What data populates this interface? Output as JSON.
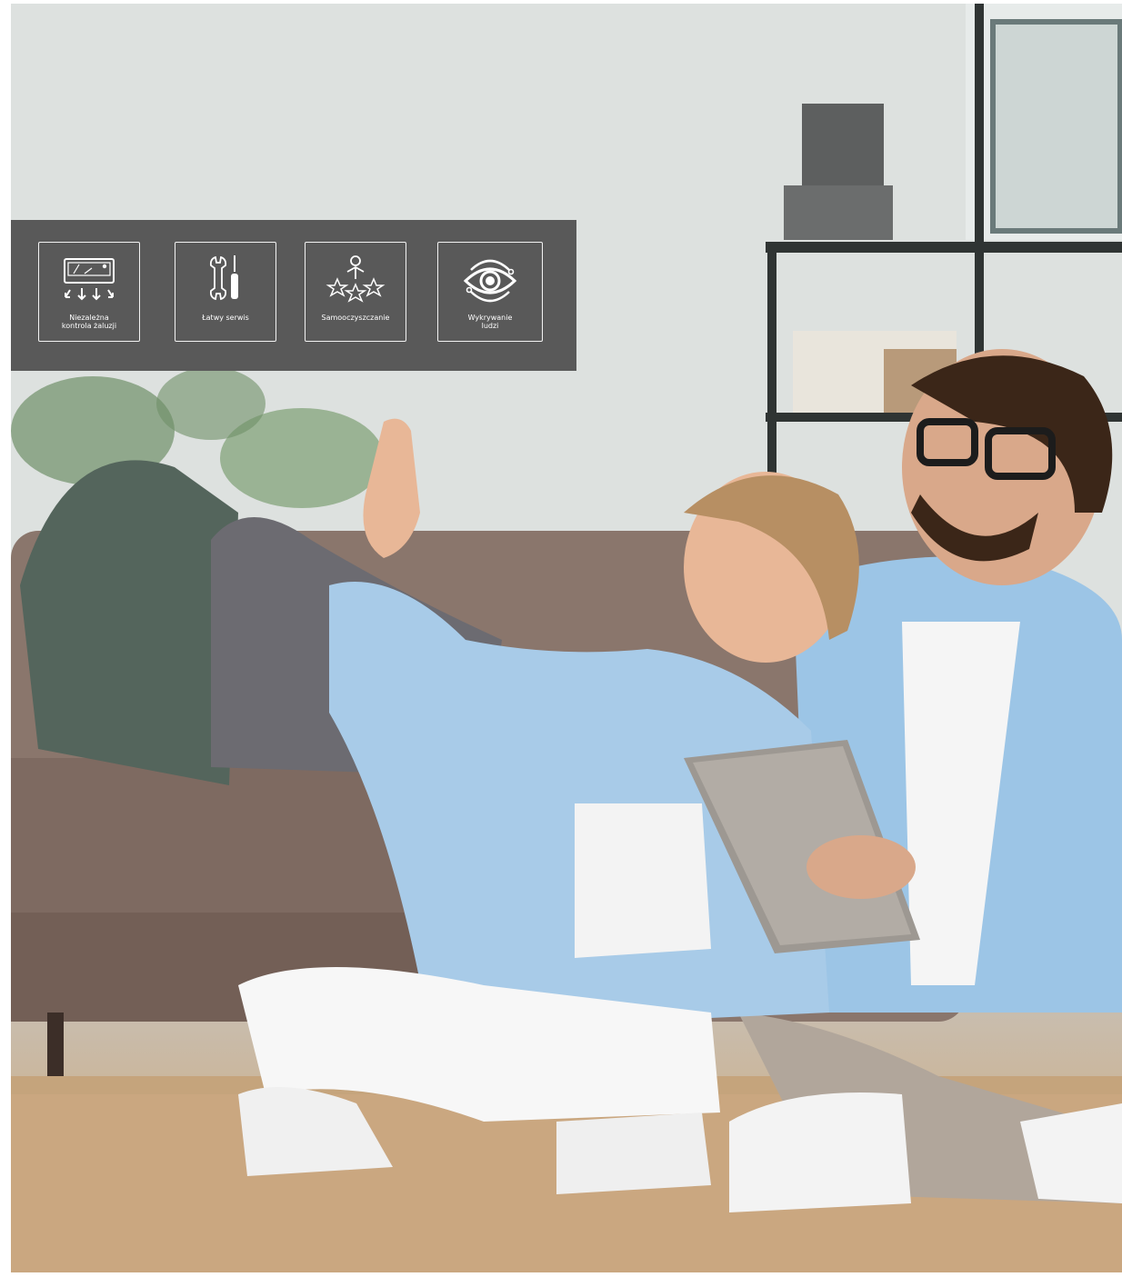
{
  "photo": {
    "description_alt": ""
  },
  "features": [
    {
      "label": "Niezależna\nkontrola żaluzji",
      "icon": "louver-control-icon"
    },
    {
      "label": "Łatwy serwis",
      "icon": "service-tools-icon"
    },
    {
      "label": "Samooczyszczanie",
      "icon": "self-cleaning-icon"
    },
    {
      "label": "Wykrywanie\nludzi",
      "icon": "eye-detection-icon"
    }
  ],
  "colors": {
    "bar_background": "#595959",
    "card_border": "#f2f2f2",
    "shirt_blue": "#9cc5e6"
  }
}
